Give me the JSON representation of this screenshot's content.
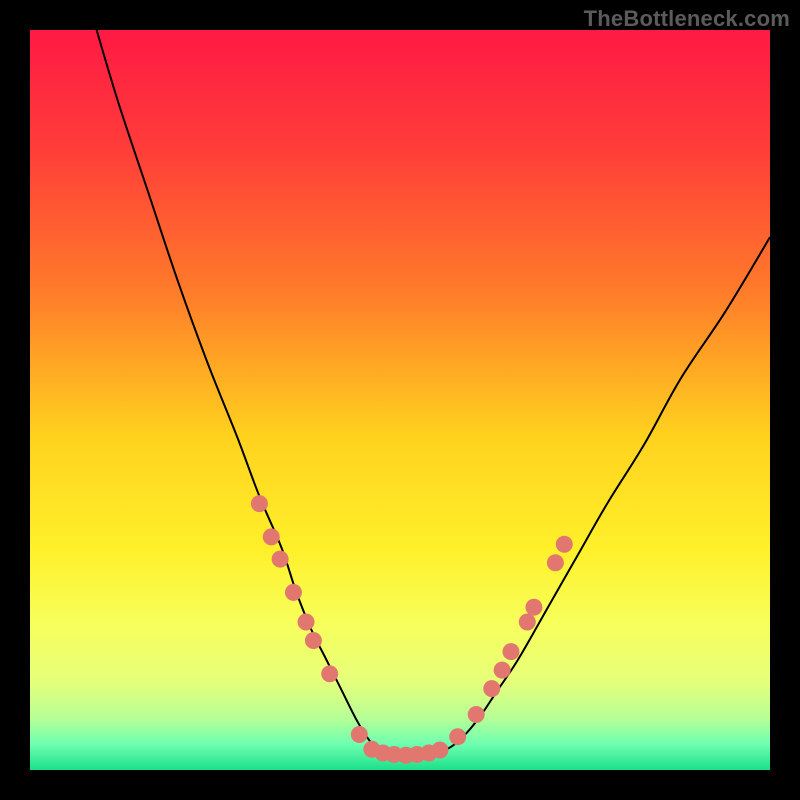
{
  "watermark": "TheBottleneck.com",
  "colors": {
    "page_bg": "#000000",
    "curve": "#000000",
    "dot": "#e2776f",
    "gradient_stops": [
      {
        "offset": 0.0,
        "color": "#ff1a44"
      },
      {
        "offset": 0.15,
        "color": "#ff3a3a"
      },
      {
        "offset": 0.35,
        "color": "#ff7a2a"
      },
      {
        "offset": 0.55,
        "color": "#ffd21e"
      },
      {
        "offset": 0.7,
        "color": "#fff02a"
      },
      {
        "offset": 0.8,
        "color": "#f7ff5a"
      },
      {
        "offset": 0.88,
        "color": "#e6ff7a"
      },
      {
        "offset": 0.93,
        "color": "#b6ff96"
      },
      {
        "offset": 0.965,
        "color": "#6effb0"
      },
      {
        "offset": 1.0,
        "color": "#1be08a"
      }
    ]
  },
  "chart_data": {
    "type": "line",
    "title": "",
    "xlabel": "",
    "ylabel": "",
    "xlim": [
      0,
      100
    ],
    "ylim": [
      0,
      100
    ],
    "grid": false,
    "note": "Chart has no visible numeric axes; values are approximate, read from curve position within the 0–100 × 0–100 plot box.",
    "series": [
      {
        "name": "curve",
        "x": [
          9,
          12,
          16,
          20,
          24,
          28,
          31,
          34,
          36,
          38,
          40,
          42,
          44,
          45.5,
          47,
          49,
          51,
          53,
          55,
          57,
          59,
          61,
          63,
          66,
          70,
          74,
          78,
          83,
          88,
          94,
          100
        ],
        "y": [
          100,
          90,
          78,
          66,
          55,
          45,
          37,
          30,
          24,
          19,
          15,
          11,
          7,
          4.5,
          2.8,
          2.0,
          2.0,
          2.0,
          2.3,
          3.2,
          5.0,
          7.5,
          10.5,
          15,
          22,
          29,
          36,
          44,
          53,
          62,
          72
        ]
      }
    ],
    "markers": [
      {
        "x": 31.0,
        "y": 36.0
      },
      {
        "x": 32.6,
        "y": 31.5
      },
      {
        "x": 33.8,
        "y": 28.5
      },
      {
        "x": 35.6,
        "y": 24.0
      },
      {
        "x": 37.3,
        "y": 20.0
      },
      {
        "x": 38.3,
        "y": 17.5
      },
      {
        "x": 40.5,
        "y": 13.0
      },
      {
        "x": 44.5,
        "y": 4.8
      },
      {
        "x": 46.2,
        "y": 2.8
      },
      {
        "x": 47.7,
        "y": 2.3
      },
      {
        "x": 49.2,
        "y": 2.1
      },
      {
        "x": 50.8,
        "y": 2.0
      },
      {
        "x": 52.3,
        "y": 2.1
      },
      {
        "x": 53.9,
        "y": 2.3
      },
      {
        "x": 55.4,
        "y": 2.7
      },
      {
        "x": 57.8,
        "y": 4.5
      },
      {
        "x": 60.3,
        "y": 7.5
      },
      {
        "x": 62.4,
        "y": 11.0
      },
      {
        "x": 63.8,
        "y": 13.5
      },
      {
        "x": 65.0,
        "y": 16.0
      },
      {
        "x": 67.2,
        "y": 20.0
      },
      {
        "x": 68.1,
        "y": 22.0
      },
      {
        "x": 71.0,
        "y": 28.0
      },
      {
        "x": 72.2,
        "y": 30.5
      }
    ]
  }
}
